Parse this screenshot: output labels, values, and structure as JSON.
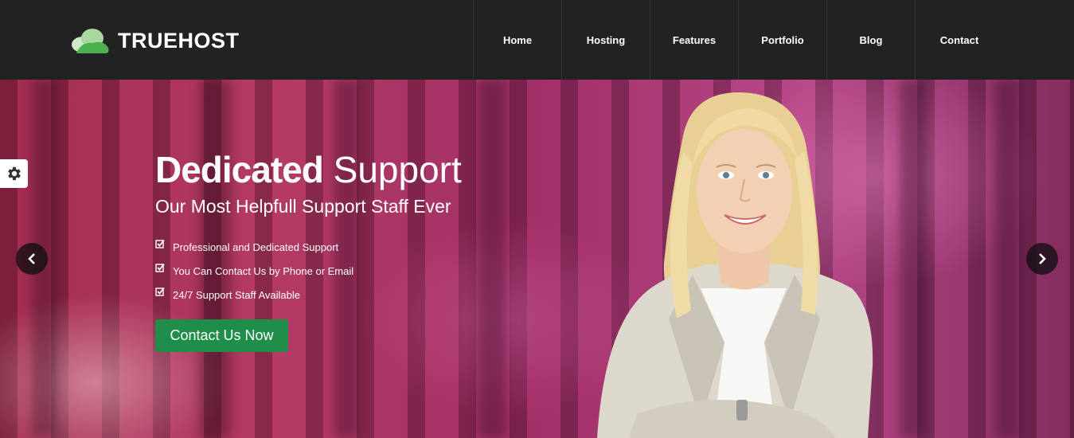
{
  "brand": {
    "name": "TRUEHOST"
  },
  "nav": {
    "items": [
      {
        "label": "Home"
      },
      {
        "label": "Hosting"
      },
      {
        "label": "Features"
      },
      {
        "label": "Portfolio"
      },
      {
        "label": "Blog"
      },
      {
        "label": "Contact"
      }
    ]
  },
  "hero": {
    "title_bold": "Dedicated",
    "title_rest": " Support",
    "subtitle": "Our Most Helpfull Support Staff Ever",
    "features": [
      {
        "text": "Professional and Dedicated Support"
      },
      {
        "text": "You Can Contact Us by Phone or Email"
      },
      {
        "text": "24/7 Support Staff Available"
      }
    ],
    "cta_label": "Contact Us Now"
  },
  "icons": {
    "logo": "cloud-icon",
    "settings": "gear-icon",
    "prev": "chevron-left-icon",
    "next": "chevron-right-icon",
    "feature": "checkbox-checked-icon"
  },
  "colors": {
    "header_bg": "#222222",
    "cta_bg": "#1e8e4a",
    "logo_green_light": "#a8d8a0",
    "logo_green_dark": "#4caf50"
  }
}
